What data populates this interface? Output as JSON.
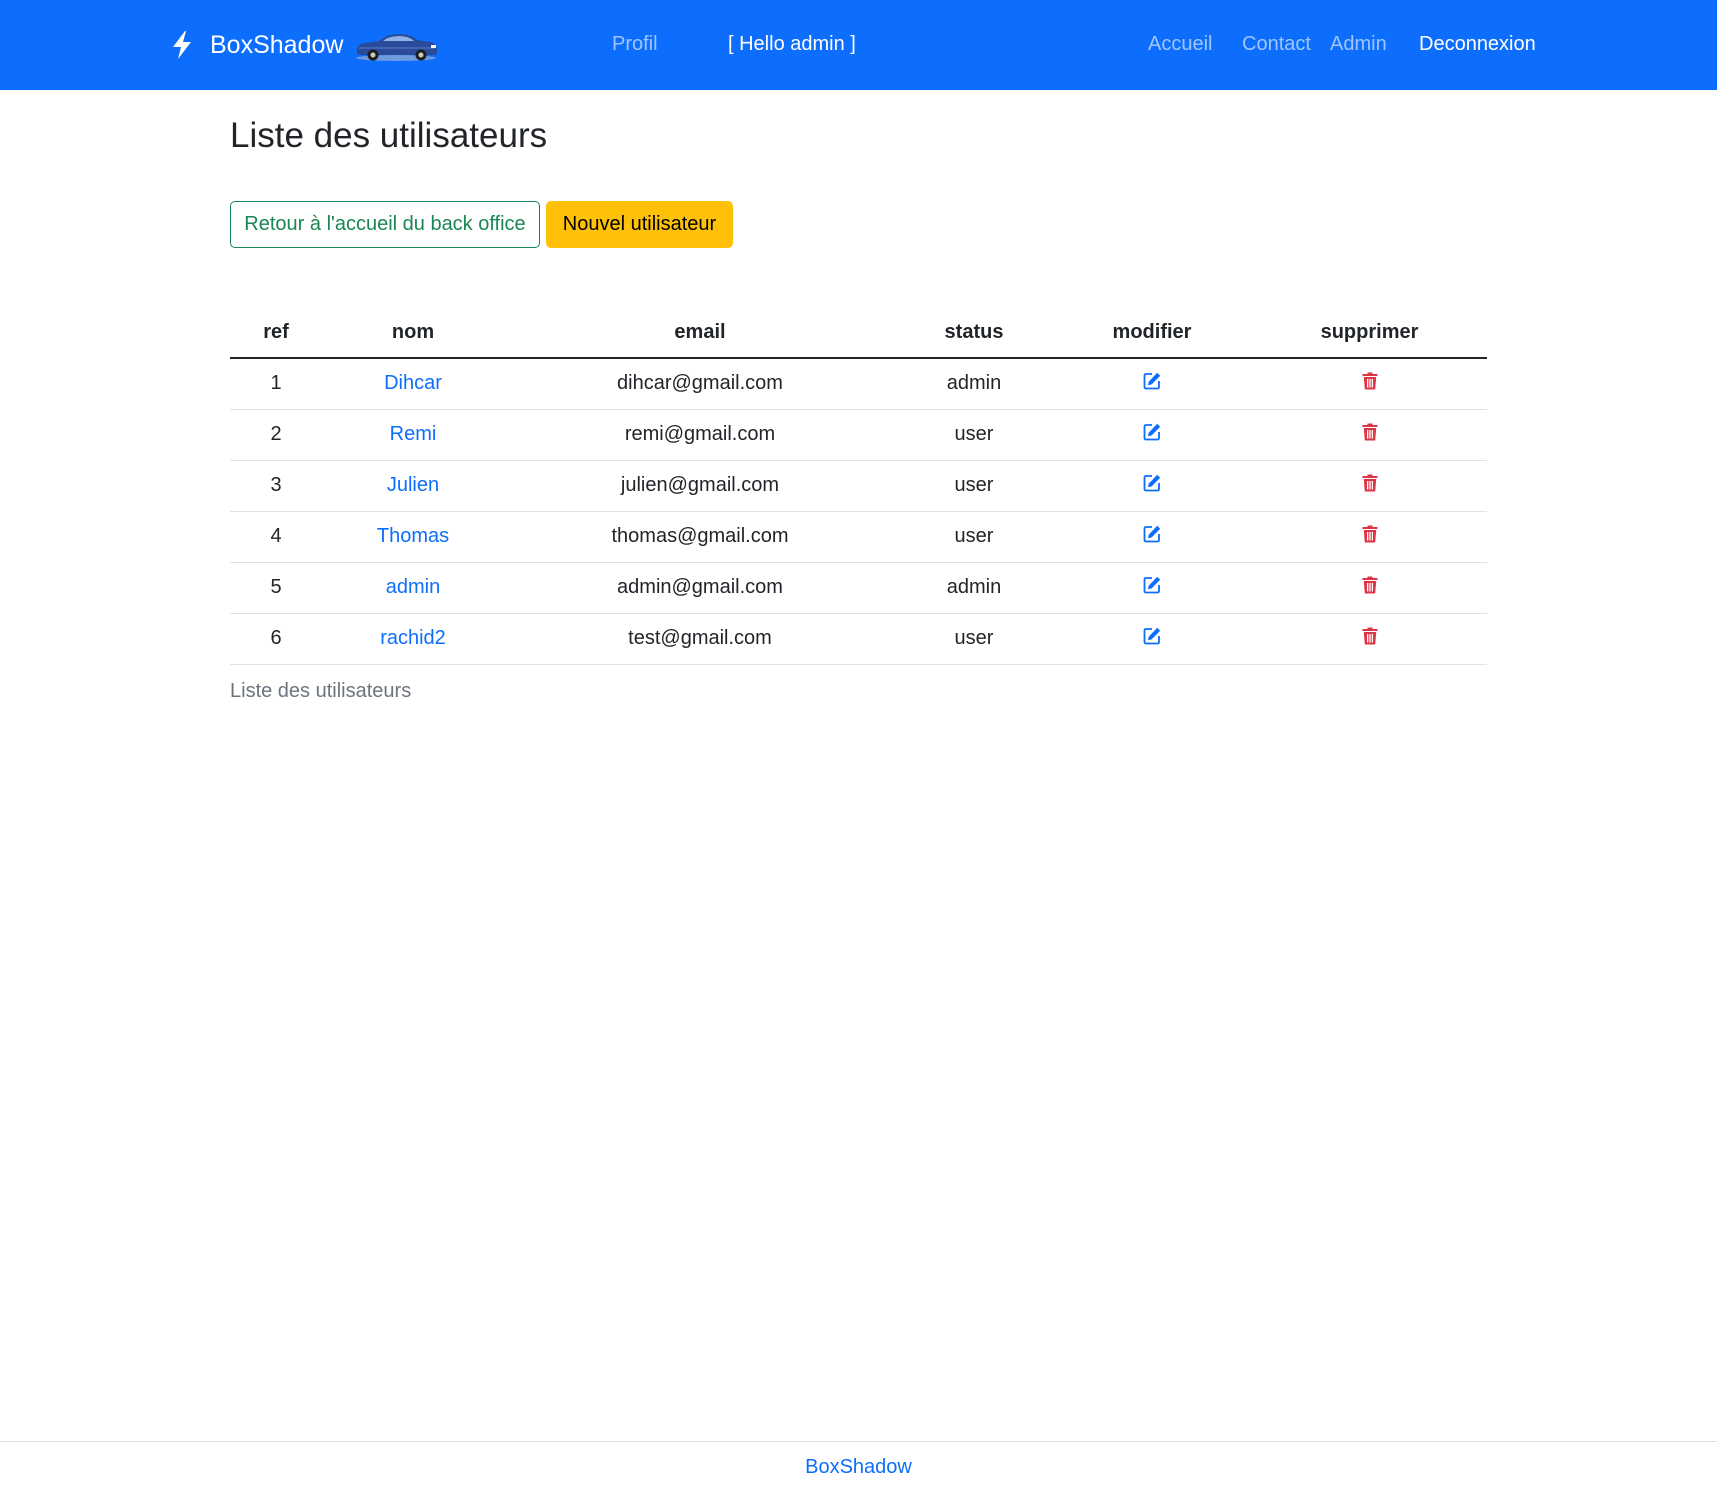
{
  "navbar": {
    "brand": "BoxShadow",
    "links": {
      "profil": "Profil",
      "greeting": "[ Hello admin ]",
      "accueil": "Accueil",
      "contact": "Contact",
      "admin": "Admin",
      "deconnexion": "Deconnexion"
    },
    "background_color": "#0d6efd"
  },
  "main": {
    "title": "Liste des utilisateurs",
    "buttons": {
      "back": "Retour à l'accueil du back office",
      "new_user": "Nouvel utilisateur"
    },
    "table": {
      "headers": [
        "ref",
        "nom",
        "email",
        "status",
        "modifier",
        "supprimer"
      ],
      "rows": [
        {
          "ref": "1",
          "nom": "Dihcar",
          "email": "dihcar@gmail.com",
          "status": "admin"
        },
        {
          "ref": "2",
          "nom": "Remi",
          "email": "remi@gmail.com",
          "status": "user"
        },
        {
          "ref": "3",
          "nom": "Julien",
          "email": "julien@gmail.com",
          "status": "user"
        },
        {
          "ref": "4",
          "nom": "Thomas",
          "email": "thomas@gmail.com",
          "status": "user"
        },
        {
          "ref": "5",
          "nom": "admin",
          "email": "admin@gmail.com",
          "status": "admin"
        },
        {
          "ref": "6",
          "nom": "rachid2",
          "email": "test@gmail.com",
          "status": "user"
        }
      ],
      "caption": "Liste des utilisateurs",
      "edit_icon": "edit-icon",
      "delete_icon": "trash-icon"
    }
  },
  "footer": {
    "brand": "BoxShadow"
  },
  "colors": {
    "primary": "#0d6efd",
    "success": "#198754",
    "warning": "#ffc107",
    "danger": "#dc3545",
    "muted": "#6c757d"
  }
}
